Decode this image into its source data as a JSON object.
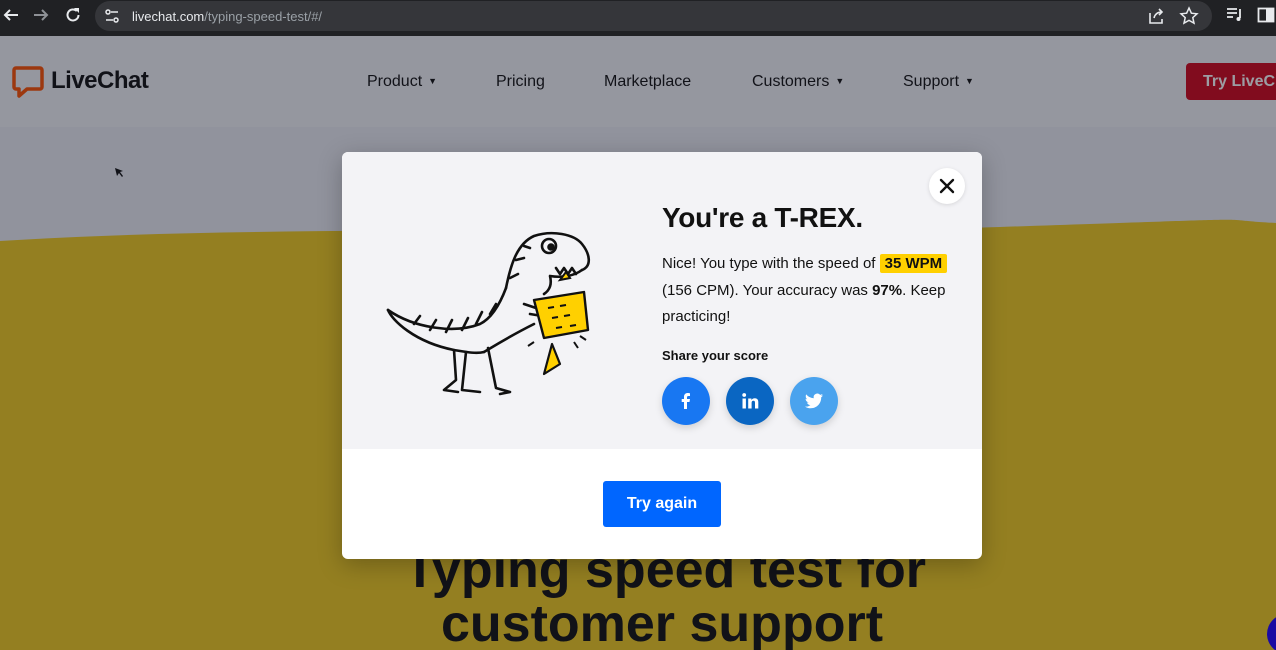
{
  "browser": {
    "url_domain": "livechat.com",
    "url_path": "/typing-speed-test/#/"
  },
  "header": {
    "logo_text": "LiveChat",
    "nav": [
      "Product",
      "Pricing",
      "Marketplace",
      "Customers",
      "Support"
    ],
    "cta_label": "Try LiveCh"
  },
  "hero": {
    "title_line1": "Typing speed test for",
    "title_line2": "customer support"
  },
  "modal": {
    "title": "You're a T-REX.",
    "text_prefix": "Nice! You type with the speed of",
    "wpm": "35 WPM",
    "cpm_text": "(156 CPM). Your accuracy was",
    "accuracy": "97%",
    "text_suffix": ". Keep practicing!",
    "share_label": "Share your score",
    "try_again_label": "Try again"
  },
  "colors": {
    "hero_yellow": "#f2cc1f",
    "cta_red": "#d0061a",
    "try_again_blue": "#0066ff",
    "wpm_highlight": "#ffd000",
    "facebook": "#1877f2",
    "linkedin": "#0a66c2",
    "twitter": "#4aa3ee"
  }
}
